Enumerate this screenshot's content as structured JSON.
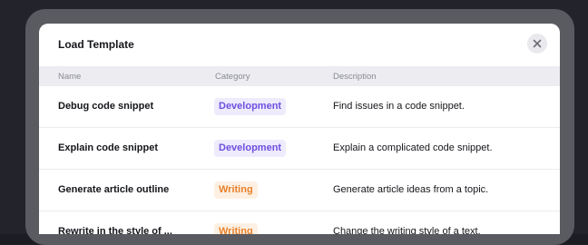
{
  "modal": {
    "title": "Load Template",
    "close_icon": "close-icon"
  },
  "table": {
    "headers": {
      "name": "Name",
      "category": "Category",
      "description": "Description"
    },
    "rows": [
      {
        "name": "Debug code snippet",
        "category": "Development",
        "category_color": "#6e4fe0",
        "category_bg": "#eeebfd",
        "description": "Find issues in a code snippet."
      },
      {
        "name": "Explain code snippet",
        "category": "Development",
        "category_color": "#6e4fe0",
        "category_bg": "#eeebfd",
        "description": "Explain a complicated code snippet."
      },
      {
        "name": "Generate article outline",
        "category": "Writing",
        "category_color": "#e8812b",
        "category_bg": "#fdf0e3",
        "description": "Generate article ideas from a topic."
      },
      {
        "name": "Rewrite in the style of ...",
        "category": "Writing",
        "category_color": "#e8812b",
        "category_bg": "#fdf0e3",
        "description": "Change the writing style of a text."
      }
    ]
  }
}
